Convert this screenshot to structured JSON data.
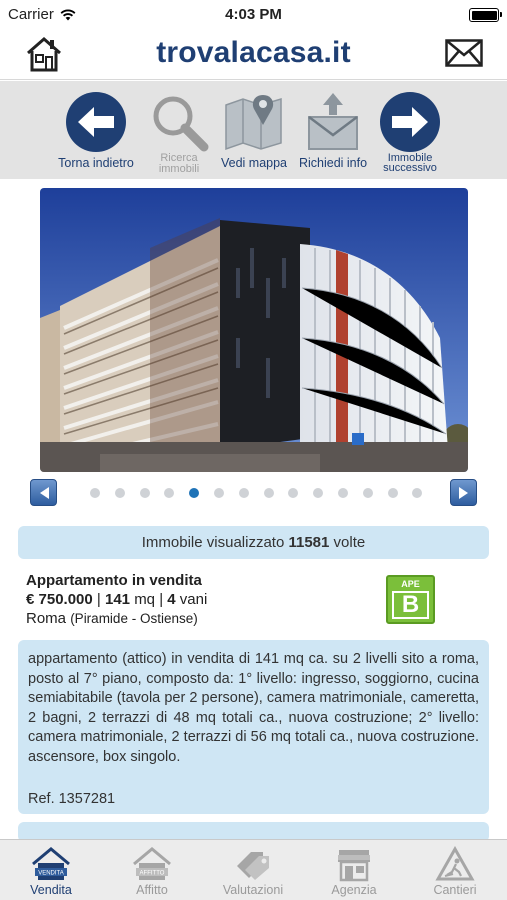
{
  "status": {
    "carrier": "Carrier",
    "time": "4:03 PM"
  },
  "header": {
    "logo": "trovalacasa.it"
  },
  "toolbar": {
    "back": "Torna indietro",
    "search_line1": "Ricerca",
    "search_line2": "immobili",
    "map": "Vedi mappa",
    "request": "Richiedi info",
    "next_line1": "Immobile",
    "next_line2": "successivo"
  },
  "gallery": {
    "total": 14,
    "active_index": 4
  },
  "views": {
    "prefix": "Immobile visualizzato",
    "count": "11581",
    "suffix": "volte"
  },
  "listing": {
    "type": "Appartamento  in vendita",
    "price": "€ 750.000",
    "sep": "|",
    "sqm": "141",
    "sqm_unit": "mq",
    "rooms": "4",
    "rooms_unit": "vani",
    "city": "Roma",
    "zone": "(Piramide - Ostiense)",
    "ape_label": "APE",
    "ape_class": "B"
  },
  "description": {
    "text": "appartamento (attico) in vendita di 141 mq ca. su 2 livelli sito a roma, posto al 7° piano, composto da: 1° livello: ingresso, soggiorno, cucina semiabitabile (tavola per 2 persone), camera matrimoniale, cameretta, 2 bagni, 2 terrazzi di 48 mq totali ca., nuova costruzione; 2° livello: camera matrimoniale, 2 terrazzi di 56 mq totali ca., nuova costruzione. ascensore, box singolo.",
    "ref": "Ref. 1357281"
  },
  "tabs": [
    {
      "label": "Vendita",
      "icon": "house-sale-icon",
      "active": true
    },
    {
      "label": "Affitto",
      "icon": "house-rent-icon",
      "active": false
    },
    {
      "label": "Valutazioni",
      "icon": "price-tags-icon",
      "active": false
    },
    {
      "label": "Agenzia",
      "icon": "storefront-icon",
      "active": false
    },
    {
      "label": "Cantieri",
      "icon": "construction-icon",
      "active": false
    }
  ],
  "colors": {
    "brand": "#1f3f73",
    "info_bg": "#cfe6f4",
    "ape_green": "#7bbf3a",
    "dot_active": "#1f73b7"
  }
}
